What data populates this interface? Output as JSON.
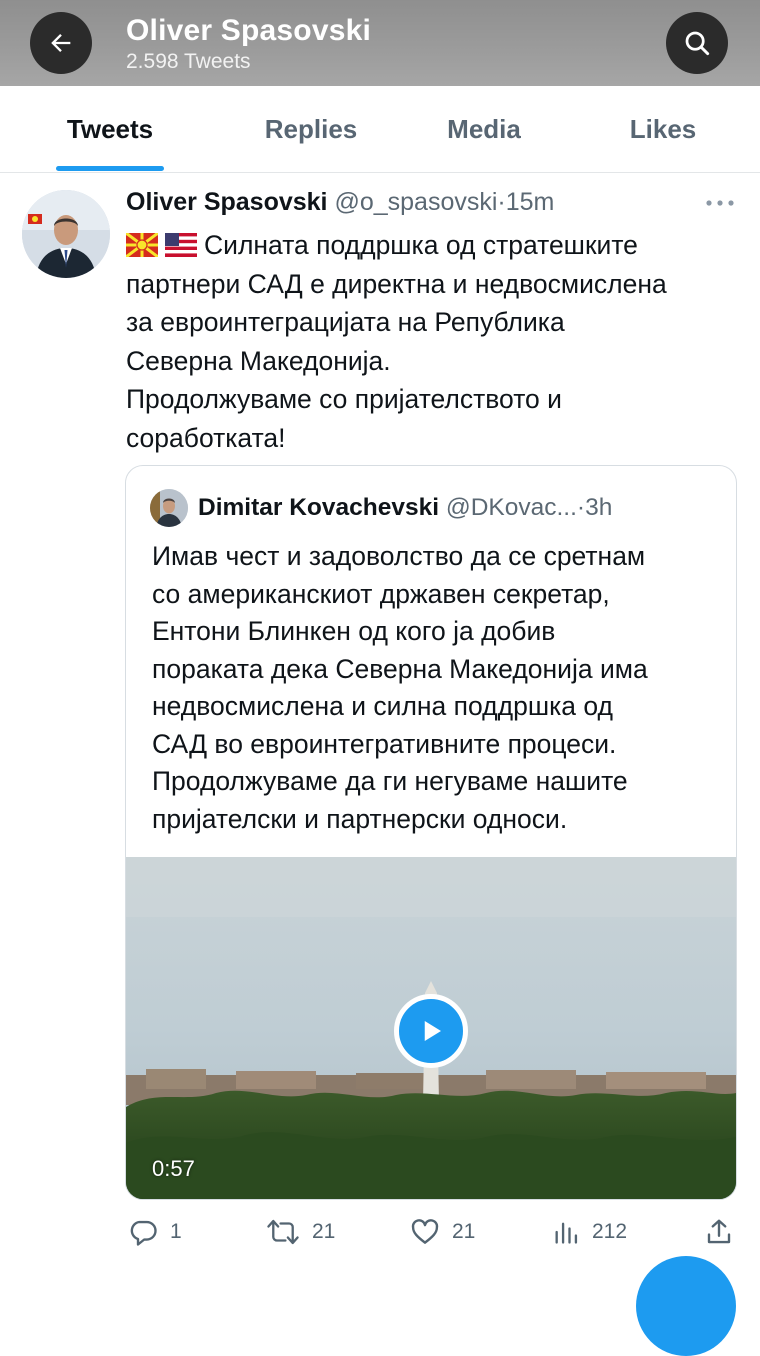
{
  "header": {
    "title": "Oliver Spasovski",
    "subtitle": "2.598 Tweets",
    "back_icon": "arrow-left-icon",
    "search_icon": "search-icon"
  },
  "tabs": [
    {
      "label": "Tweets",
      "active": true
    },
    {
      "label": "Replies",
      "active": false
    },
    {
      "label": "Media",
      "active": false
    },
    {
      "label": "Likes",
      "active": false
    }
  ],
  "tweet": {
    "author_name": "Oliver Spasovski",
    "handle": "@o_spasovski",
    "separator": "·",
    "time": "15m",
    "text_lines": [
      "Силната поддршка од стратешките",
      "партнери САД е директна и недвосмислена",
      "за евроинтеграцијата на Република",
      "Северна Македонија.",
      "Продолжуваме со пријателството и",
      "соработката!"
    ],
    "flags": [
      "macedonia-flag-icon",
      "usa-flag-icon"
    ]
  },
  "quote": {
    "author_name": "Dimitar Kovachevski",
    "handle": "@DKovac...",
    "separator": "·",
    "time": "3h",
    "text_lines": [
      "Имав чест и задоволство да се сретнам",
      "со американскиот државен секретар,",
      "Ентони Блинкен од кого ја добив",
      "пораката дека Северна Македонија има",
      "недвосмислена и силна поддршка од",
      "САД во евроинтегративните процеси.",
      "Продолжуваме да ги негуваме нашите",
      "пријателски и партнерски односи."
    ],
    "video_duration": "0:57"
  },
  "actions": {
    "replies": "1",
    "retweets": "21",
    "likes": "21",
    "views": "212"
  },
  "colors": {
    "accent": "#1d9bf0",
    "text": "#0f1419",
    "muted": "#536471",
    "header_bg": "#9a9a9a"
  }
}
